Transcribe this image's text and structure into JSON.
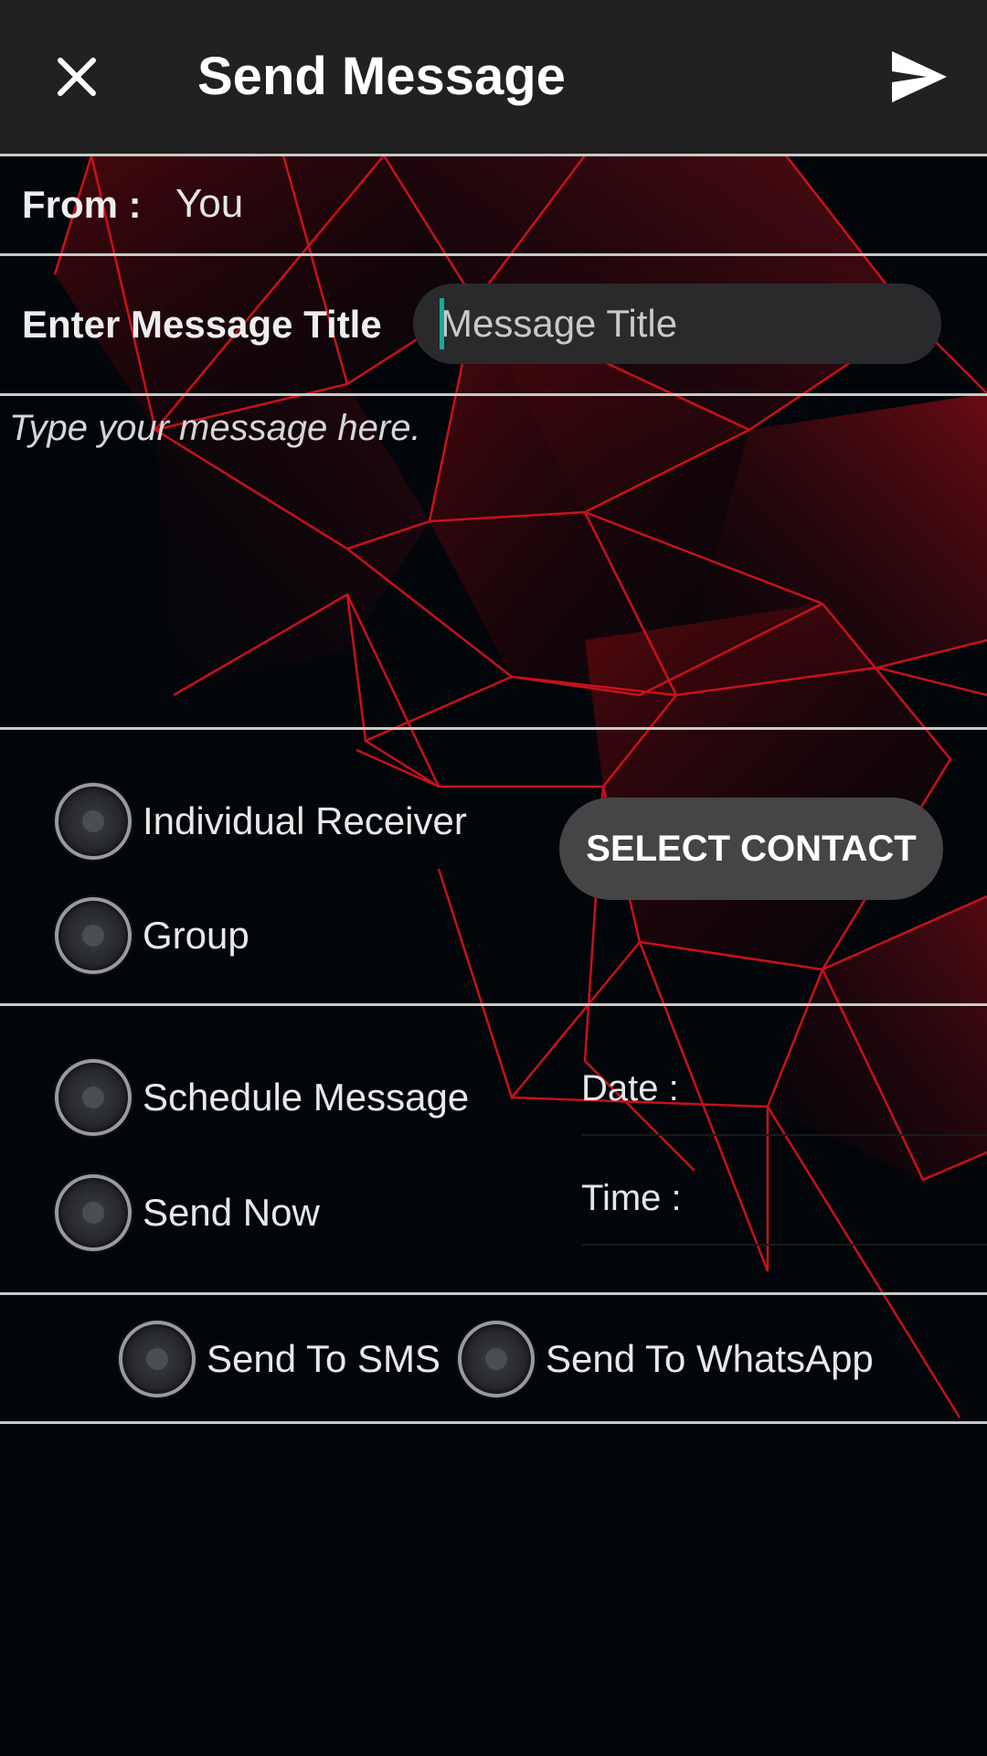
{
  "appbar": {
    "title": "Send Message",
    "close_icon": "close-icon",
    "send_icon": "send-icon",
    "background": "#212121"
  },
  "from": {
    "label": "From :",
    "value": "You"
  },
  "message_title": {
    "label": "Enter Message Title",
    "placeholder": "Message Title",
    "value": ""
  },
  "message_body": {
    "placeholder": "Type your message here.",
    "value": ""
  },
  "receiver": {
    "options": [
      "Individual Receiver",
      "Group"
    ],
    "select_contact_label": "SELECT CONTACT"
  },
  "schedule": {
    "options": [
      "Schedule Message",
      "Send Now"
    ],
    "date_label": "Date :",
    "time_label": "Time :"
  },
  "channel": {
    "options": [
      "Send To SMS",
      "Send To WhatsApp"
    ]
  },
  "colors": {
    "background": "#02050a",
    "accent_red": "#e0141e",
    "caret": "#1aa89a",
    "button": "#454545"
  }
}
